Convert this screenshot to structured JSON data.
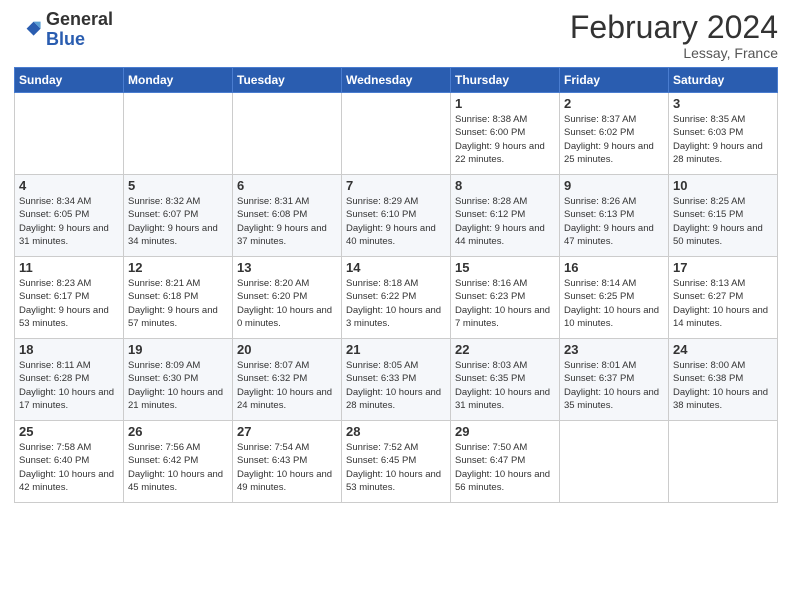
{
  "header": {
    "logo_line1": "General",
    "logo_line2": "Blue",
    "month_title": "February 2024",
    "location": "Lessay, France"
  },
  "weekdays": [
    "Sunday",
    "Monday",
    "Tuesday",
    "Wednesday",
    "Thursday",
    "Friday",
    "Saturday"
  ],
  "weeks": [
    [
      {
        "day": "",
        "info": ""
      },
      {
        "day": "",
        "info": ""
      },
      {
        "day": "",
        "info": ""
      },
      {
        "day": "",
        "info": ""
      },
      {
        "day": "1",
        "info": "Sunrise: 8:38 AM\nSunset: 6:00 PM\nDaylight: 9 hours\nand 22 minutes."
      },
      {
        "day": "2",
        "info": "Sunrise: 8:37 AM\nSunset: 6:02 PM\nDaylight: 9 hours\nand 25 minutes."
      },
      {
        "day": "3",
        "info": "Sunrise: 8:35 AM\nSunset: 6:03 PM\nDaylight: 9 hours\nand 28 minutes."
      }
    ],
    [
      {
        "day": "4",
        "info": "Sunrise: 8:34 AM\nSunset: 6:05 PM\nDaylight: 9 hours\nand 31 minutes."
      },
      {
        "day": "5",
        "info": "Sunrise: 8:32 AM\nSunset: 6:07 PM\nDaylight: 9 hours\nand 34 minutes."
      },
      {
        "day": "6",
        "info": "Sunrise: 8:31 AM\nSunset: 6:08 PM\nDaylight: 9 hours\nand 37 minutes."
      },
      {
        "day": "7",
        "info": "Sunrise: 8:29 AM\nSunset: 6:10 PM\nDaylight: 9 hours\nand 40 minutes."
      },
      {
        "day": "8",
        "info": "Sunrise: 8:28 AM\nSunset: 6:12 PM\nDaylight: 9 hours\nand 44 minutes."
      },
      {
        "day": "9",
        "info": "Sunrise: 8:26 AM\nSunset: 6:13 PM\nDaylight: 9 hours\nand 47 minutes."
      },
      {
        "day": "10",
        "info": "Sunrise: 8:25 AM\nSunset: 6:15 PM\nDaylight: 9 hours\nand 50 minutes."
      }
    ],
    [
      {
        "day": "11",
        "info": "Sunrise: 8:23 AM\nSunset: 6:17 PM\nDaylight: 9 hours\nand 53 minutes."
      },
      {
        "day": "12",
        "info": "Sunrise: 8:21 AM\nSunset: 6:18 PM\nDaylight: 9 hours\nand 57 minutes."
      },
      {
        "day": "13",
        "info": "Sunrise: 8:20 AM\nSunset: 6:20 PM\nDaylight: 10 hours\nand 0 minutes."
      },
      {
        "day": "14",
        "info": "Sunrise: 8:18 AM\nSunset: 6:22 PM\nDaylight: 10 hours\nand 3 minutes."
      },
      {
        "day": "15",
        "info": "Sunrise: 8:16 AM\nSunset: 6:23 PM\nDaylight: 10 hours\nand 7 minutes."
      },
      {
        "day": "16",
        "info": "Sunrise: 8:14 AM\nSunset: 6:25 PM\nDaylight: 10 hours\nand 10 minutes."
      },
      {
        "day": "17",
        "info": "Sunrise: 8:13 AM\nSunset: 6:27 PM\nDaylight: 10 hours\nand 14 minutes."
      }
    ],
    [
      {
        "day": "18",
        "info": "Sunrise: 8:11 AM\nSunset: 6:28 PM\nDaylight: 10 hours\nand 17 minutes."
      },
      {
        "day": "19",
        "info": "Sunrise: 8:09 AM\nSunset: 6:30 PM\nDaylight: 10 hours\nand 21 minutes."
      },
      {
        "day": "20",
        "info": "Sunrise: 8:07 AM\nSunset: 6:32 PM\nDaylight: 10 hours\nand 24 minutes."
      },
      {
        "day": "21",
        "info": "Sunrise: 8:05 AM\nSunset: 6:33 PM\nDaylight: 10 hours\nand 28 minutes."
      },
      {
        "day": "22",
        "info": "Sunrise: 8:03 AM\nSunset: 6:35 PM\nDaylight: 10 hours\nand 31 minutes."
      },
      {
        "day": "23",
        "info": "Sunrise: 8:01 AM\nSunset: 6:37 PM\nDaylight: 10 hours\nand 35 minutes."
      },
      {
        "day": "24",
        "info": "Sunrise: 8:00 AM\nSunset: 6:38 PM\nDaylight: 10 hours\nand 38 minutes."
      }
    ],
    [
      {
        "day": "25",
        "info": "Sunrise: 7:58 AM\nSunset: 6:40 PM\nDaylight: 10 hours\nand 42 minutes."
      },
      {
        "day": "26",
        "info": "Sunrise: 7:56 AM\nSunset: 6:42 PM\nDaylight: 10 hours\nand 45 minutes."
      },
      {
        "day": "27",
        "info": "Sunrise: 7:54 AM\nSunset: 6:43 PM\nDaylight: 10 hours\nand 49 minutes."
      },
      {
        "day": "28",
        "info": "Sunrise: 7:52 AM\nSunset: 6:45 PM\nDaylight: 10 hours\nand 53 minutes."
      },
      {
        "day": "29",
        "info": "Sunrise: 7:50 AM\nSunset: 6:47 PM\nDaylight: 10 hours\nand 56 minutes."
      },
      {
        "day": "",
        "info": ""
      },
      {
        "day": "",
        "info": ""
      }
    ]
  ]
}
